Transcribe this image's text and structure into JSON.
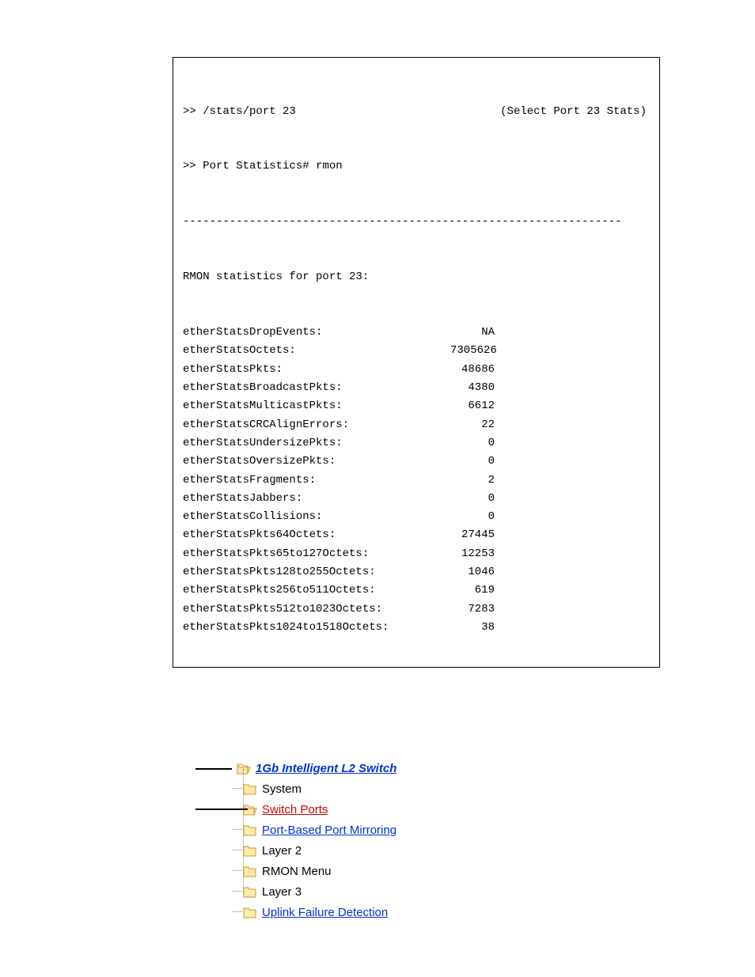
{
  "terminal": {
    "cmd1_prefix": ">> ",
    "cmd1": "/stats/port 23",
    "cmd1_note": "(Select Port 23 Stats)",
    "cmd2_prefix": ">> ",
    "cmd2": "Port Statistics# rmon",
    "divider": "------------------------------------------------------------------",
    "header": "RMON statistics for port 23:",
    "stats": [
      {
        "label": "etherStatsDropEvents:",
        "value": "NA"
      },
      {
        "label": "etherStatsOctets:",
        "value": "7305626"
      },
      {
        "label": "etherStatsPkts:",
        "value": "48686"
      },
      {
        "label": "etherStatsBroadcastPkts:",
        "value": "4380"
      },
      {
        "label": "etherStatsMulticastPkts:",
        "value": "6612"
      },
      {
        "label": "etherStatsCRCAlignErrors:",
        "value": "22"
      },
      {
        "label": "etherStatsUndersizePkts:",
        "value": "0"
      },
      {
        "label": "etherStatsOversizePkts:",
        "value": "0"
      },
      {
        "label": "etherStatsFragments:",
        "value": "2"
      },
      {
        "label": "etherStatsJabbers:",
        "value": "0"
      },
      {
        "label": "etherStatsCollisions:",
        "value": "0"
      },
      {
        "label": "etherStatsPkts64Octets:",
        "value": "27445"
      },
      {
        "label": "etherStatsPkts65to127Octets:",
        "value": "12253"
      },
      {
        "label": "etherStatsPkts128to255Octets:",
        "value": "1046"
      },
      {
        "label": "etherStatsPkts256to511Octets:",
        "value": "619"
      },
      {
        "label": "etherStatsPkts512to1023Octets:",
        "value": "7283"
      },
      {
        "label": "etherStatsPkts1024to1518Octets:",
        "value": "38"
      }
    ]
  },
  "tree": {
    "root": "1Gb Intelligent L2 Switch",
    "items": [
      {
        "label": "System",
        "link": false,
        "highlight": false
      },
      {
        "label": "Switch Ports",
        "link": true,
        "highlight": true
      },
      {
        "label": "Port-Based Port Mirroring",
        "link": true,
        "highlight": false
      },
      {
        "label": "Layer 2",
        "link": false,
        "highlight": false
      },
      {
        "label": "RMON Menu",
        "link": false,
        "highlight": false
      },
      {
        "label": "Layer 3",
        "link": false,
        "highlight": false
      },
      {
        "label": "Uplink Failure Detection",
        "link": true,
        "highlight": false
      }
    ]
  }
}
